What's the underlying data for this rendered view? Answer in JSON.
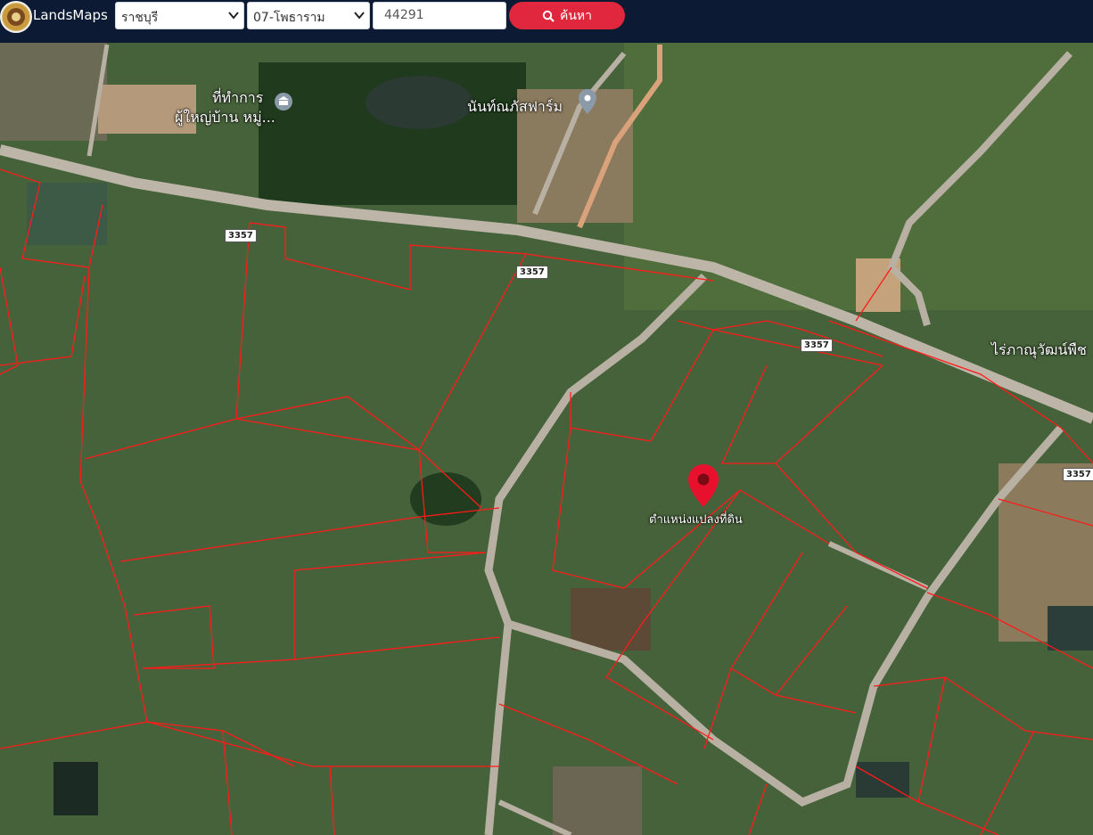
{
  "header": {
    "brand": "LandsMaps",
    "province": "ราชบุรี",
    "district": "07-โพธาราม",
    "parcel_number": "44291",
    "search_label": "ค้นหา",
    "accent": "#e0273e",
    "background": "#0c1b33"
  },
  "map": {
    "places": [
      {
        "id": "office",
        "label_line1": "ที่ทำการ",
        "label_line2": "ผู้ใหญ่บ้าน หมู่...",
        "icon": "museum-icon"
      },
      {
        "id": "farm",
        "label": "นันท์ณภัสฟาร์ม",
        "icon": "map-pin-icon"
      },
      {
        "id": "plantation",
        "label": "ไร่ภาณุวัฒน์พืช"
      }
    ],
    "road_shields": [
      "3357",
      "3357",
      "3357",
      "3357"
    ],
    "marker_label": "ตำแหน่งแปลงที่ดิน",
    "marker_color": "#e8112d",
    "parcel_line_color": "#ff1a1a"
  }
}
